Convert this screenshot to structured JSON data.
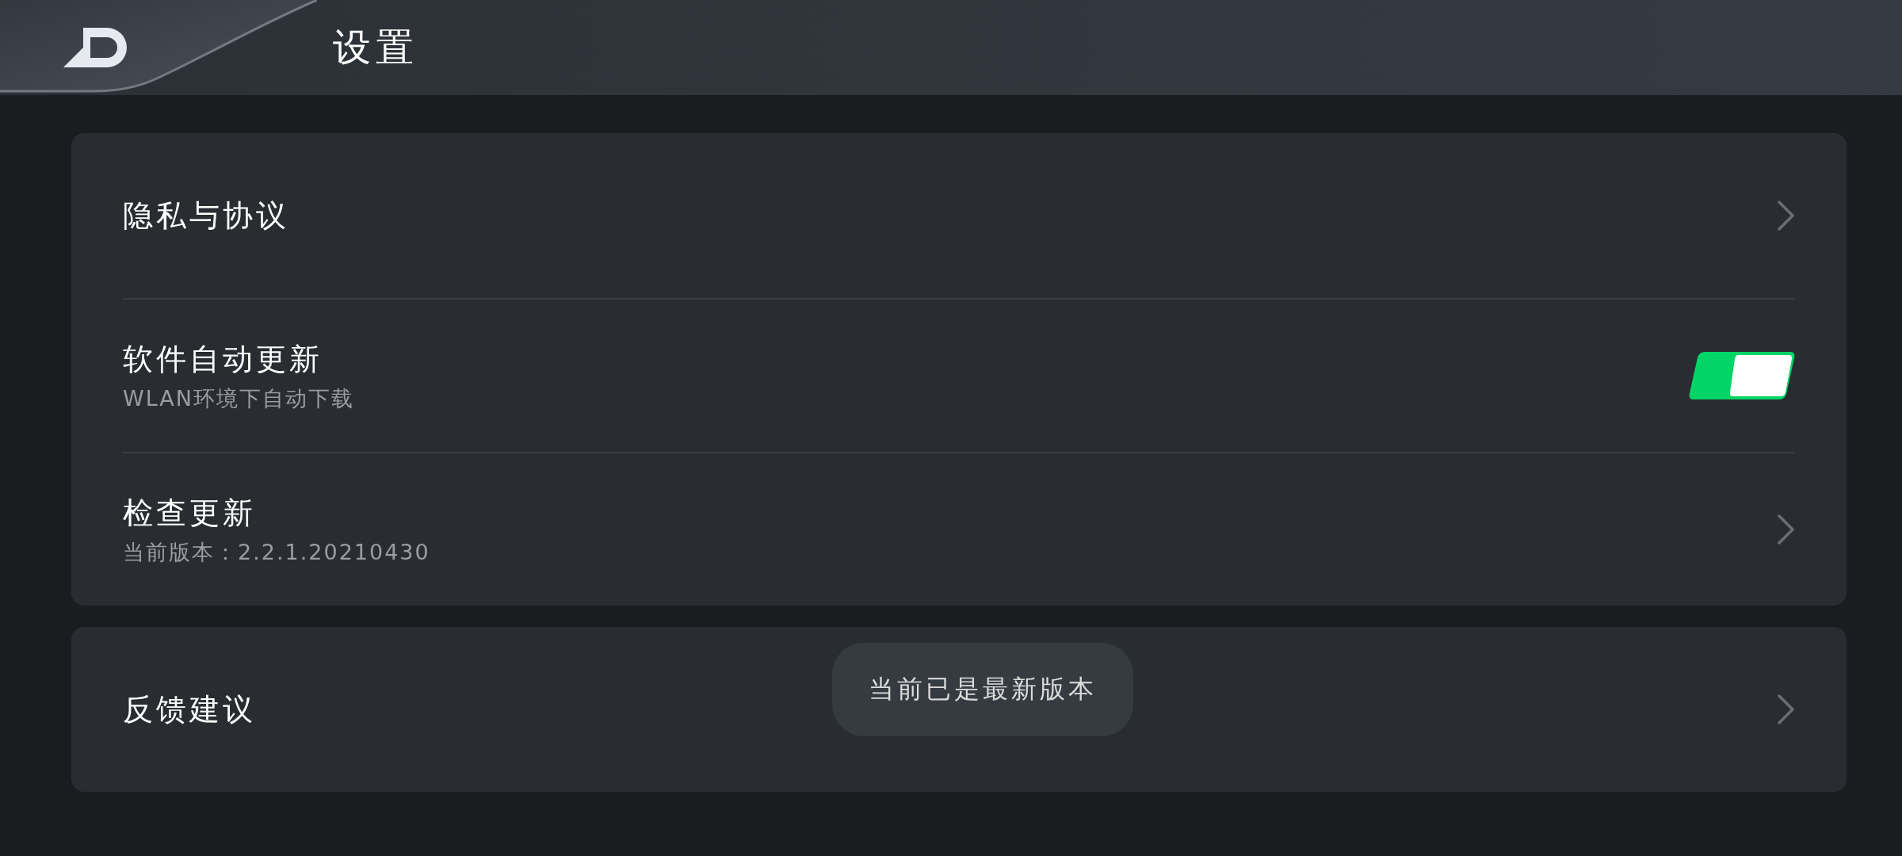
{
  "header": {
    "title": "设置"
  },
  "groups": [
    {
      "rows": [
        {
          "kind": "link",
          "title": "隐私与协议"
        },
        {
          "kind": "switch",
          "title": "软件自动更新",
          "subtitle": "WLAN环境下自动下载",
          "on": true
        },
        {
          "kind": "link",
          "title": "检查更新",
          "subtitle": "当前版本：2.2.1.20210430"
        }
      ]
    },
    {
      "rows": [
        {
          "kind": "link",
          "title": "反馈建议"
        }
      ]
    }
  ],
  "toast": {
    "text": "当前已是最新版本"
  }
}
